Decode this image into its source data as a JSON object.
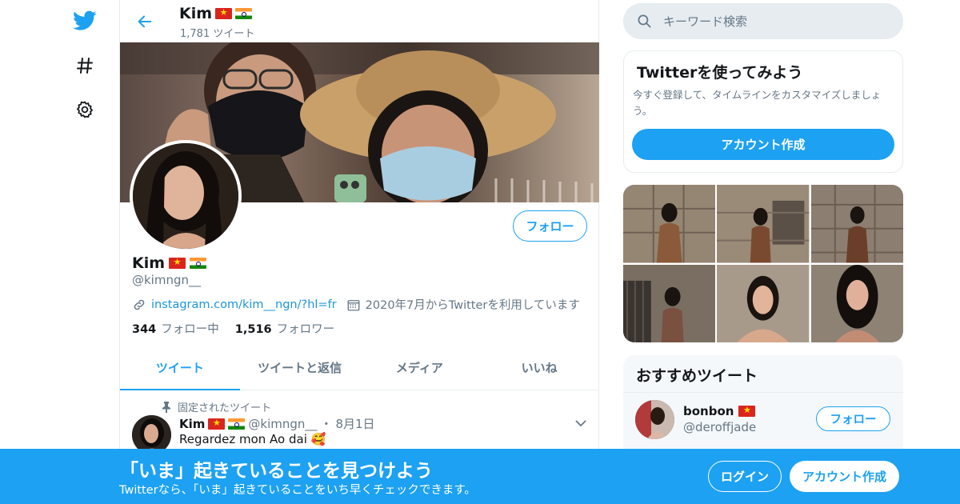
{
  "colors": {
    "brand": "#1da1f2",
    "text": "#14171a",
    "muted": "#657786",
    "border": "#e6ecf0"
  },
  "nav": {
    "icons": [
      "twitter-bird-icon",
      "hashtag-icon",
      "gear-icon"
    ]
  },
  "header": {
    "name": "Kim",
    "tweet_count": "1,781 ツイート"
  },
  "profile": {
    "name": "Kim",
    "handle": "@kimngn__",
    "follow_label": "フォロー",
    "link": "instagram.com/kim__ngn/?hl=fr",
    "joined": "2020年7月からTwitterを利用しています",
    "following_count": "344",
    "following_label": "フォロー中",
    "followers_count": "1,516",
    "followers_label": "フォロワー"
  },
  "tabs": [
    {
      "label": "ツイート",
      "active": true
    },
    {
      "label": "ツイートと返信",
      "active": false
    },
    {
      "label": "メディア",
      "active": false
    },
    {
      "label": "いいね",
      "active": false
    }
  ],
  "pinned_tweet": {
    "pinned_label": "固定されたツイート",
    "author": "Kim",
    "handle": "@kimngn__",
    "separator": "・",
    "date": "8月1日",
    "text": "Regardez mon Ao dai 🥰"
  },
  "search": {
    "placeholder": "キーワード検索"
  },
  "signup_card": {
    "title": "Twitterを使ってみよう",
    "description": "今すぐ登録して、タイムラインをカスタマイズしましょう。",
    "button_label": "アカウント作成"
  },
  "recommended": {
    "title": "おすすめツイート",
    "users": [
      {
        "name": "bonbon",
        "handle": "@deroffjade",
        "follow_label": "フォロー"
      }
    ]
  },
  "bottom_bar": {
    "title": "「いま」起きていることを見つけよう",
    "subtitle": "Twitterなら、「いま」起きていることをいち早くチェックできます。",
    "login_label": "ログイン",
    "signup_label": "アカウント作成"
  }
}
